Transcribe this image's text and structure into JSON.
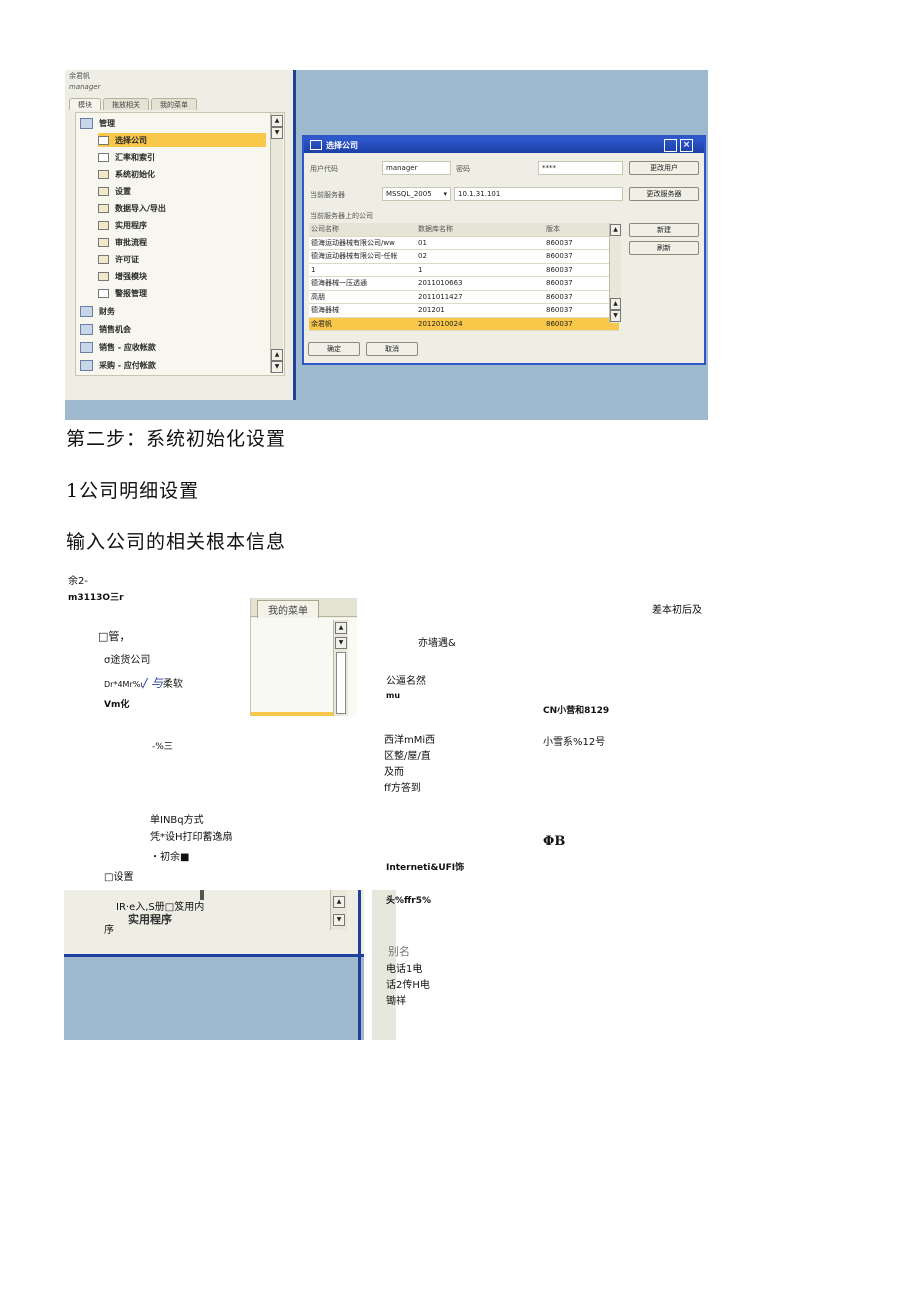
{
  "screenshot": {
    "user": "余君帆",
    "role": "manager",
    "tabs": [
      "模块",
      "拖放相关",
      "我的菜单"
    ],
    "tree": [
      {
        "label": "管理",
        "level": 0,
        "icon": "admin-icon"
      },
      {
        "label": "选择公司",
        "level": 1,
        "icon": "doc-icon",
        "selected": true
      },
      {
        "label": "汇率和索引",
        "level": 1,
        "icon": "doc-icon"
      },
      {
        "label": "系统初始化",
        "level": 1,
        "icon": "folder-icon"
      },
      {
        "label": "设置",
        "level": 1,
        "icon": "folder-icon"
      },
      {
        "label": "数据导入/导出",
        "level": 1,
        "icon": "folder-icon"
      },
      {
        "label": "实用程序",
        "level": 1,
        "icon": "folder-icon"
      },
      {
        "label": "审批流程",
        "level": 1,
        "icon": "folder-icon"
      },
      {
        "label": "许可证",
        "level": 1,
        "icon": "folder-icon"
      },
      {
        "label": "增强模块",
        "level": 1,
        "icon": "folder-icon"
      },
      {
        "label": "警报管理",
        "level": 1,
        "icon": "doc-icon"
      },
      {
        "label": "财务",
        "level": 0,
        "icon": "finance-icon"
      },
      {
        "label": "销售机会",
        "level": 0,
        "icon": "opportunity-icon"
      },
      {
        "label": "销售 - 应收帐款",
        "level": 0,
        "icon": "sales-icon"
      },
      {
        "label": "采购 - 应付帐款",
        "level": 0,
        "icon": "purchase-icon"
      }
    ],
    "dialog": {
      "title": "选择公司",
      "user_code_label": "用户代码",
      "user_code": "manager",
      "password_label": "密码",
      "password": "****",
      "server_label": "当前服务器",
      "server_type": "MSSQL_2005",
      "server_addr": "10.1.31.101",
      "companies_label": "当前服务器上的公司",
      "columns": [
        "公司名称",
        "数据库名称",
        "版本"
      ],
      "rows": [
        [
          "德海运动器械有限公司/ww",
          "01",
          "860037"
        ],
        [
          "德海运动器械有限公司-任帐",
          "02",
          "860037"
        ],
        [
          "1",
          "1",
          "860037"
        ],
        [
          "德海器械一压透通",
          "2011010663",
          "860037"
        ],
        [
          "高朋",
          "2011011427",
          "860037"
        ],
        [
          "德海器械",
          "201201",
          "860037"
        ],
        [
          "余君帆",
          "2012010024",
          "860037"
        ]
      ],
      "btn_change_user": "更改用户",
      "btn_change_server": "更改服务器",
      "btn_new": "新建",
      "btn_refresh": "刷新",
      "btn_ok": "确定",
      "btn_cancel": "取消"
    }
  },
  "headings": {
    "step2": "第二步：系统初始化设置",
    "sub1": "1公司明细设置",
    "desc": "输入公司的相关根本信息"
  },
  "collage": {
    "t1": "余2-",
    "t2": "m3113O三r",
    "frag_tab": "我的菜单",
    "t_right_top": "差本初后及",
    "t_mgmt": "□管，",
    "t_tuhuo": "σ途货公司",
    "t_rate": "Dr*4Mr%ι",
    "t_rate2": "/ 与",
    "t_rate3": "柔软",
    "t_vm": "Vm化",
    "t_yitian": "亦墙遇&",
    "t_gongsi": "公逼名然",
    "t_mu": "mu",
    "t_cn": "CN小营和8129",
    "t_pct": "-%三",
    "t_xiyang": "西洋mMi西",
    "t_qu": "区整/屋/直",
    "t_ji": "及而",
    "t_ff": "ff方答到",
    "t_xiaoxue": "小雪系%12号",
    "t_dan": "单INBq方式",
    "t_ping": "凭*设H打印蓄逸扇",
    "t_chu": "・初余■",
    "t_phi": "ΦB",
    "t_set": "□设置",
    "t_internet": "Interneti&UFI饰",
    "t_ir": "IR·e入,S册□笈用内",
    "t_xu": "序",
    "t_shiyong": "实用程序",
    "t_tou": "头%ffr5%",
    "t_bieming": "别名",
    "t_dianhua1": "电话1电",
    "t_dianhua2": "话2传H电",
    "t_youjian": "锄祥"
  }
}
